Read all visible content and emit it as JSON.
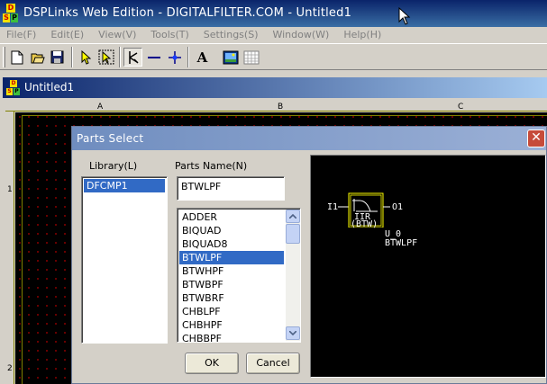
{
  "app": {
    "title": "DSPLinks Web Edition - DIGITALFILTER.COM - Untitled1",
    "icon": {
      "d": "D",
      "s": "S",
      "p": "P"
    }
  },
  "menu": [
    "File(F)",
    "Edit(E)",
    "View(V)",
    "Tools(T)",
    "Settings(S)",
    "Window(W)",
    "Help(H)"
  ],
  "toolbar": {
    "buttons": [
      "new-icon",
      "open-icon",
      "save-icon",
      "select-arrow-icon",
      "multi-select-icon",
      "place-part-icon",
      "wire-icon",
      "junction-icon",
      "text-icon",
      "image-icon",
      "grid-icon"
    ],
    "text_tool_label": "A"
  },
  "document": {
    "title": "Untitled1",
    "ruler_cols": [
      "A",
      "B",
      "C"
    ],
    "ruler_rows": [
      "1",
      "2"
    ]
  },
  "dialog": {
    "title": "Parts Select",
    "close_glyph": "✕",
    "library_label": "Library(L)",
    "parts_name_label": "Parts Name(N)",
    "parts_name_value": "BTWLPF",
    "libraries": [
      {
        "name": "DFCMP1",
        "selected": true
      }
    ],
    "parts": [
      {
        "name": "ADDER",
        "selected": false
      },
      {
        "name": "BIQUAD",
        "selected": false
      },
      {
        "name": "BIQUAD8",
        "selected": false
      },
      {
        "name": "BTWLPF",
        "selected": true
      },
      {
        "name": "BTWHPF",
        "selected": false
      },
      {
        "name": "BTWBPF",
        "selected": false
      },
      {
        "name": "BTWBRF",
        "selected": false
      },
      {
        "name": "CHBLPF",
        "selected": false
      },
      {
        "name": "CHBHPF",
        "selected": false
      },
      {
        "name": "CHBBPF",
        "selected": false
      }
    ],
    "ok_label": "OK",
    "cancel_label": "Cancel",
    "preview": {
      "input_pin": "I1",
      "output_pin": "O1",
      "block_line1": "IIR",
      "block_line2": "(BTW)",
      "instance_name": "U_0",
      "part_name": "BTWLPF"
    }
  },
  "colors": {
    "title_bar": "#0a246a",
    "dialog_title": "#6f8dbf",
    "selection": "#316ac5",
    "canvas": "#000000",
    "grid_dot": "#8b0000",
    "schematic": "#ffffff"
  }
}
